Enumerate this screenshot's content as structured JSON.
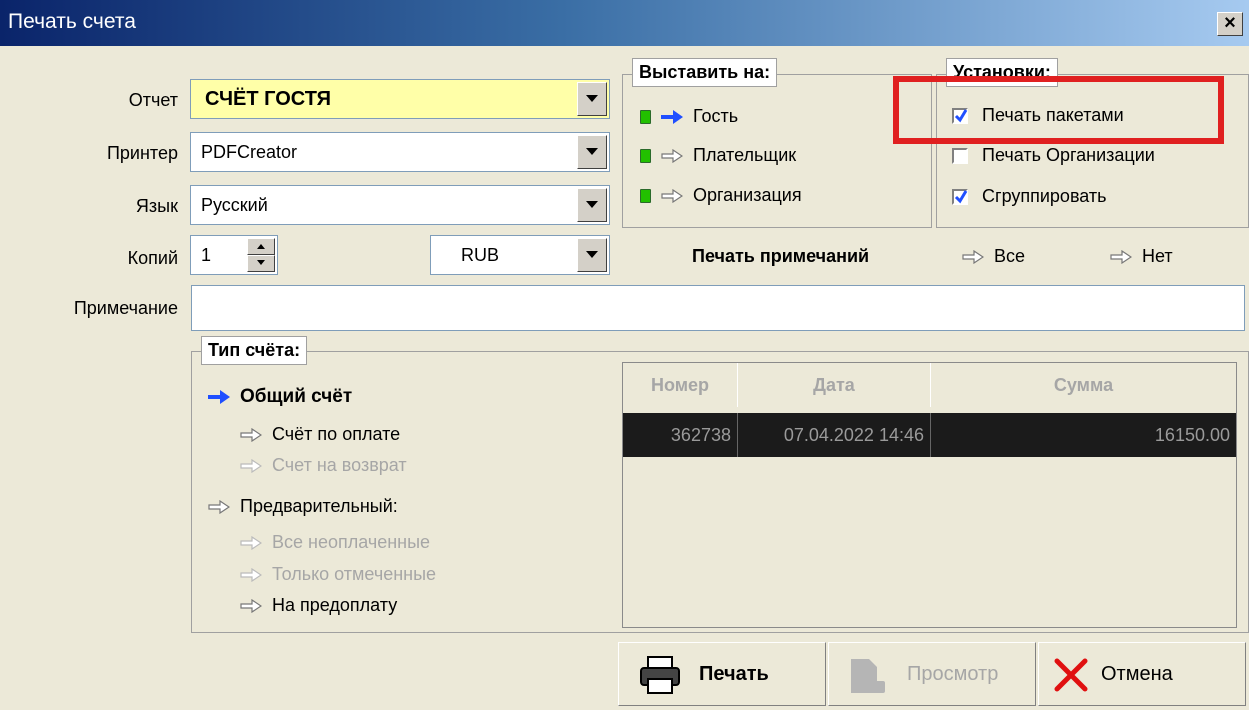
{
  "window": {
    "title": "Печать счета",
    "close_symbol": "×"
  },
  "form": {
    "report": {
      "label": "Отчет",
      "value": "СЧЁТ ГОСТЯ"
    },
    "printer": {
      "label": "Принтер",
      "value": "PDFCreator"
    },
    "language": {
      "label": "Язык",
      "value": "Русский"
    },
    "copies": {
      "label": "Копий",
      "value": "1"
    },
    "currency": {
      "value": "RUB"
    },
    "note": {
      "label": "Примечание",
      "value": ""
    }
  },
  "issue_to": {
    "title": "Выставить на:",
    "options": [
      {
        "label": "Гость",
        "selected": true
      },
      {
        "label": "Плательщик",
        "selected": false
      },
      {
        "label": "Организация",
        "selected": false
      }
    ]
  },
  "settings": {
    "title": "Установки:",
    "options": [
      {
        "label": "Печать пакетами",
        "checked": true
      },
      {
        "label": "Печать Организации",
        "checked": false
      },
      {
        "label": "Сгруппировать",
        "checked": true
      }
    ]
  },
  "print_notes": {
    "label": "Печать примечаний",
    "all": "Все",
    "none": "Нет"
  },
  "invoice_type": {
    "title": "Тип счёта:",
    "general": "Общий счёт",
    "payment": "Счёт по оплате",
    "refund": "Счет на возврат",
    "preliminary": "Предварительный:",
    "all_unpaid": "Все неоплаченные",
    "only_marked": "Только отмеченные",
    "prepayment": "На предоплату"
  },
  "table": {
    "columns": [
      "Номер",
      "Дата",
      "Сумма"
    ],
    "rows": [
      {
        "number": "362738",
        "date": "07.04.2022  14:46",
        "sum": "16150.00"
      }
    ]
  },
  "buttons": {
    "print": "Печать",
    "preview": "Просмотр",
    "cancel": "Отмена"
  },
  "colors": {
    "highlight": "#e02020",
    "report_bg": "#ffffa8",
    "arrow_selected": "#1f4fff"
  }
}
